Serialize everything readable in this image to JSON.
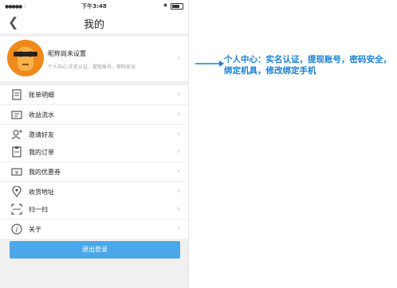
{
  "status_bar": {
    "time": "下午3:48"
  },
  "nav": {
    "title": "我的"
  },
  "profile": {
    "nickname": "昵称尚未设置",
    "subtitle": "个人中心:实名认证、提现账号、密码安全"
  },
  "groups": [
    [
      {
        "label": "账单明细",
        "icon": "bill-icon"
      },
      {
        "label": "收益流水",
        "icon": "income-icon"
      },
      {
        "label": "邀请好友",
        "icon": "invite-icon"
      }
    ],
    [
      {
        "label": "我的订单",
        "icon": "order-icon"
      },
      {
        "label": "我的优惠券",
        "icon": "coupon-icon"
      },
      {
        "label": "收货地址",
        "icon": "location-icon"
      }
    ],
    [
      {
        "label": "扫一扫",
        "icon": "scan-icon"
      },
      {
        "label": "关于",
        "icon": "info-icon"
      }
    ]
  ],
  "logout_label": "退出登录",
  "annotation": "个人中心：实名认证，提现账号，密码安全，绑定机具，修改绑定手机",
  "colors": {
    "accent": "#4aa8e8",
    "annotation": "#1a7fd1",
    "avatar": "#f08a1c"
  }
}
